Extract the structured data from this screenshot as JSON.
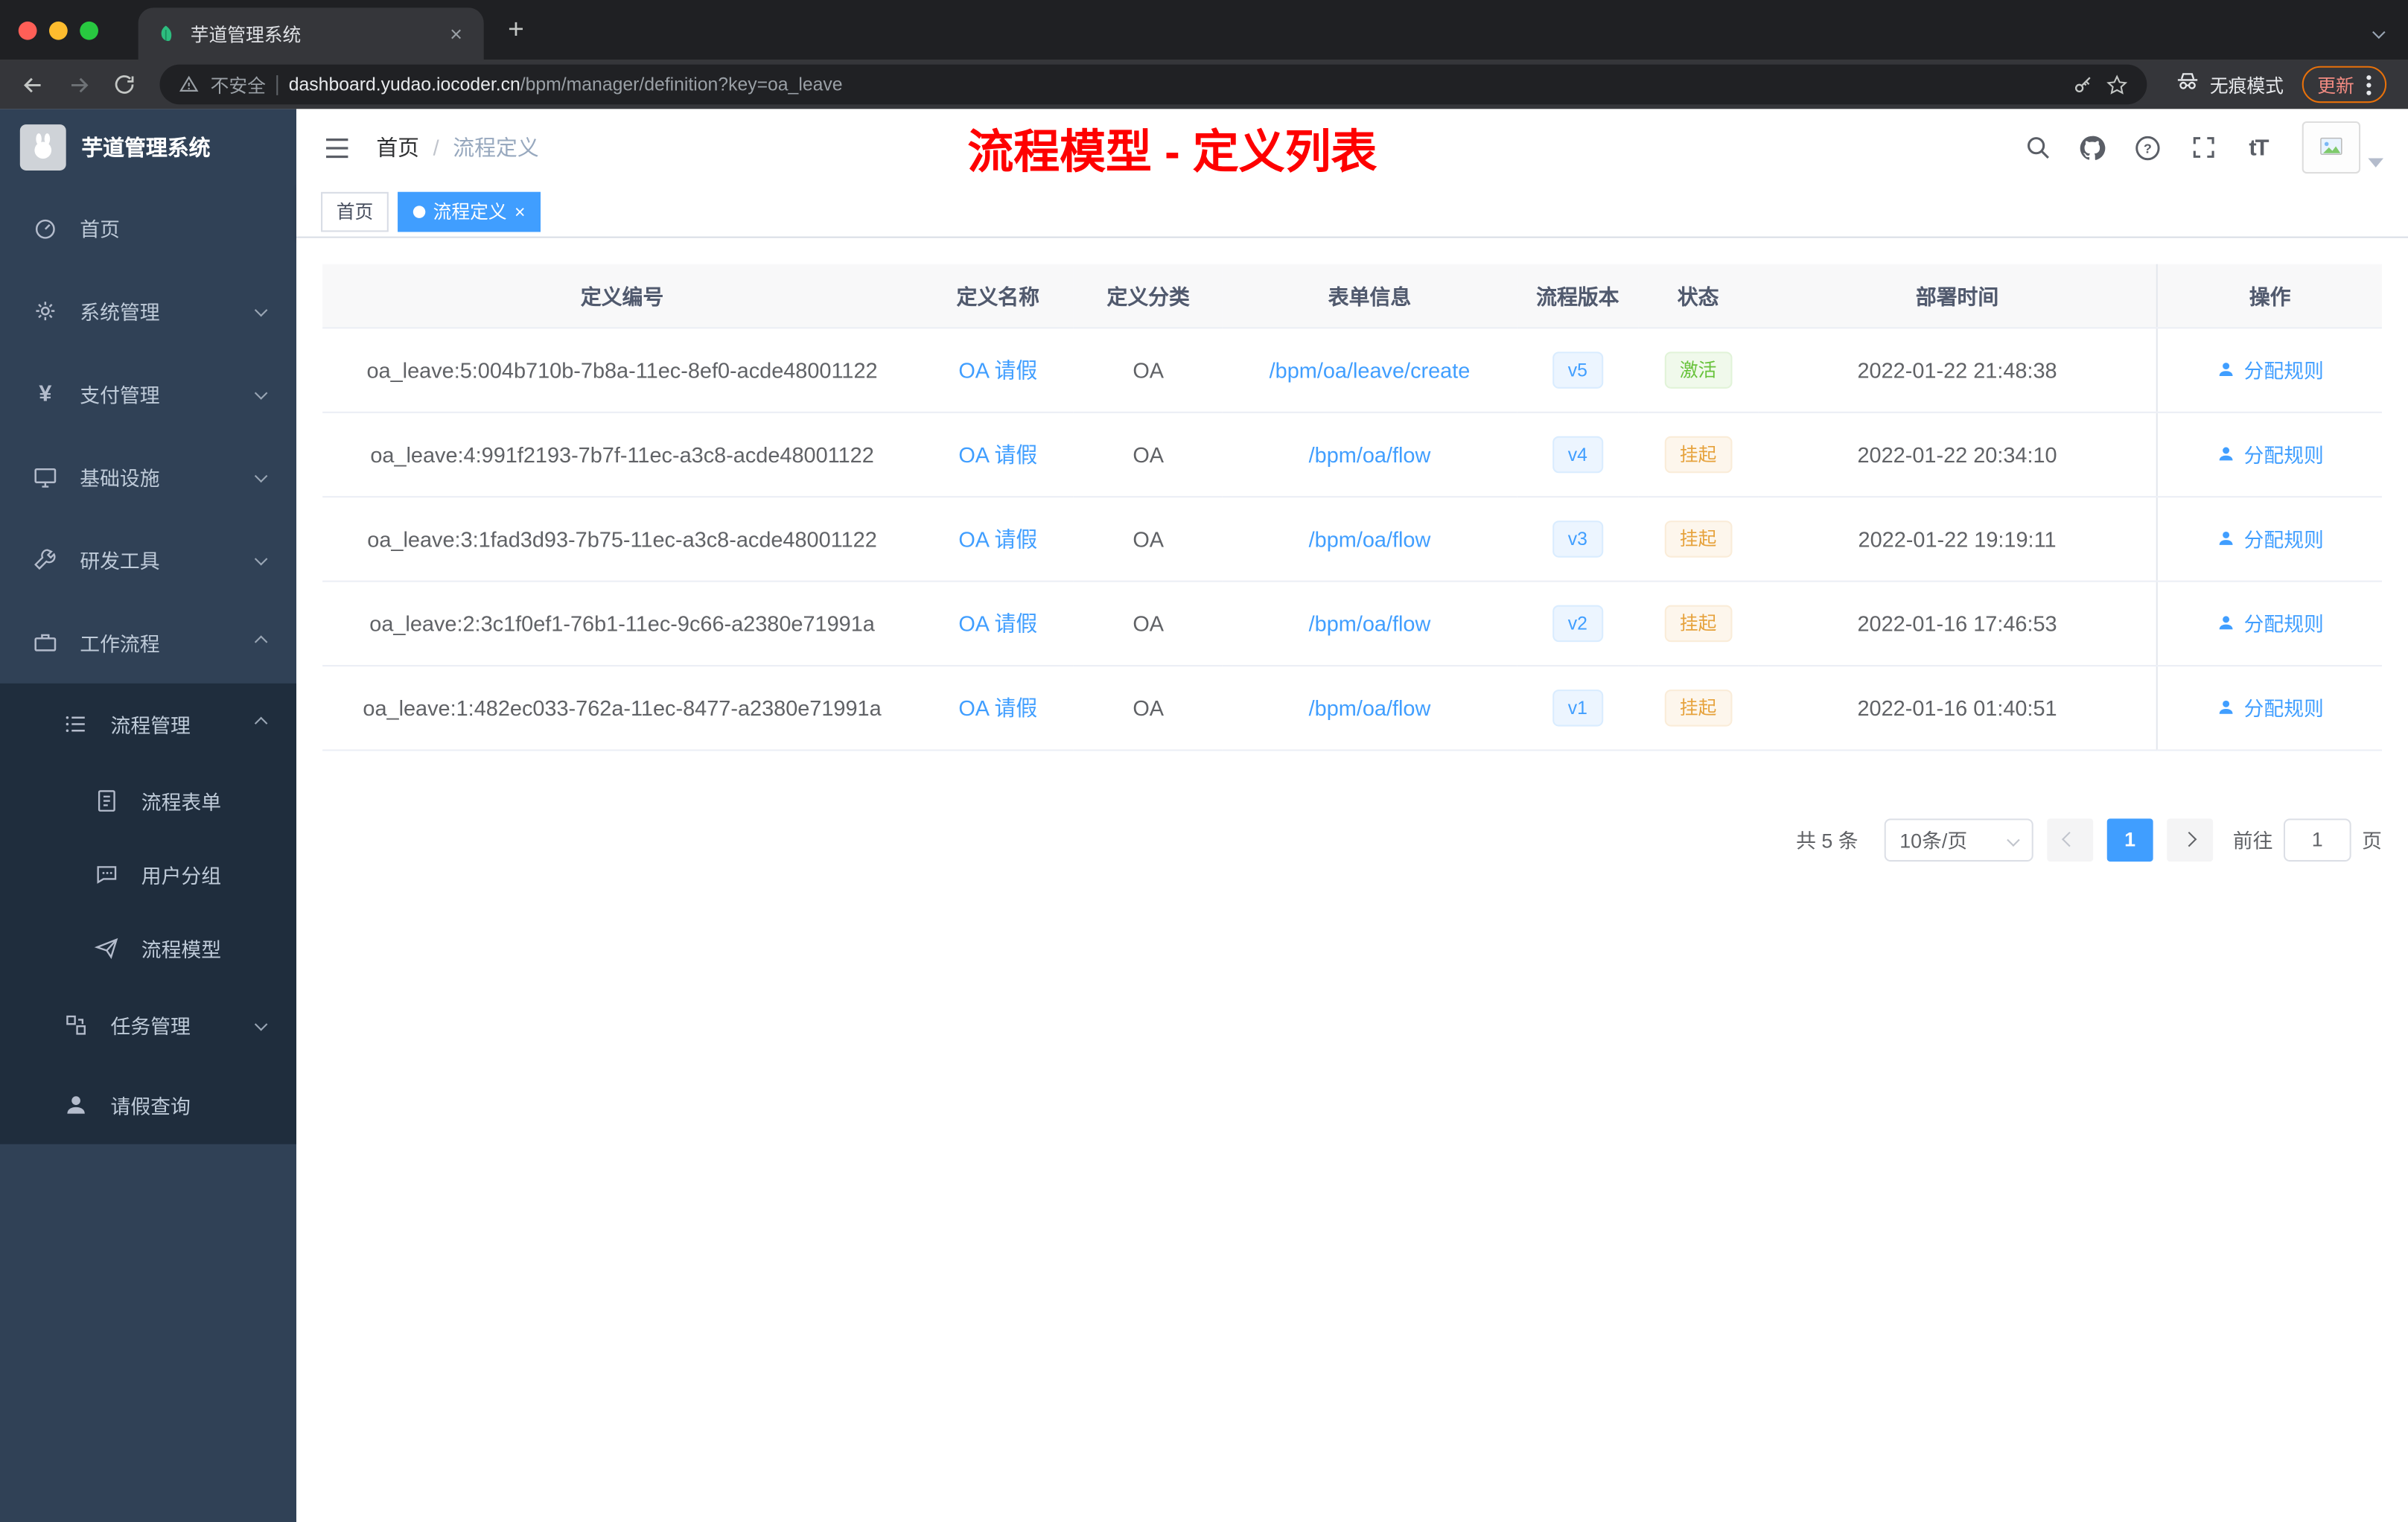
{
  "colors": {
    "accent": "#409eff",
    "sidebar_bg": "#304156",
    "submenu_bg": "#1f2d3d",
    "success": "#67c23a",
    "warning": "#e6a23c",
    "annotation_red": "#fe0000"
  },
  "browser": {
    "tab_title": "芋道管理系统",
    "security_label": "不安全",
    "url_domain": "dashboard.yudao.iocoder.cn",
    "url_path": "/bpm/manager/definition?key=oa_leave",
    "incognito_label": "无痕模式",
    "update_label": "更新"
  },
  "glyphs": {
    "close": "×",
    "plus": "+"
  },
  "sidebar": {
    "logo_title": "芋道管理系统",
    "items": [
      {
        "label": "首页"
      },
      {
        "label": "系统管理"
      },
      {
        "label": "支付管理"
      },
      {
        "label": "基础设施"
      },
      {
        "label": "研发工具"
      },
      {
        "label": "工作流程"
      },
      {
        "label": "流程管理"
      },
      {
        "label": "流程表单"
      },
      {
        "label": "用户分组"
      },
      {
        "label": "流程模型"
      },
      {
        "label": "任务管理"
      },
      {
        "label": "请假查询"
      }
    ]
  },
  "header": {
    "breadcrumb_home": "首页",
    "breadcrumb_sep": "/",
    "breadcrumb_current": "流程定义",
    "annotation": "流程模型 - 定义列表",
    "font_size_icon_label": "tT"
  },
  "tags": {
    "home": "首页",
    "active": "流程定义"
  },
  "table": {
    "columns": [
      "定义编号",
      "定义名称",
      "定义分类",
      "表单信息",
      "流程版本",
      "状态",
      "部署时间",
      "操作"
    ],
    "rows": [
      {
        "id": "oa_leave:5:004b710b-7b8a-11ec-8ef0-acde48001122",
        "name": "OA 请假",
        "category": "OA",
        "form": "/bpm/oa/leave/create",
        "version": "v5",
        "status": "激活",
        "time": "2022-01-22 21:48:38",
        "action": "分配规则"
      },
      {
        "id": "oa_leave:4:991f2193-7b7f-11ec-a3c8-acde48001122",
        "name": "OA 请假",
        "category": "OA",
        "form": "/bpm/oa/flow",
        "version": "v4",
        "status": "挂起",
        "time": "2022-01-22 20:34:10",
        "action": "分配规则"
      },
      {
        "id": "oa_leave:3:1fad3d93-7b75-11ec-a3c8-acde48001122",
        "name": "OA 请假",
        "category": "OA",
        "form": "/bpm/oa/flow",
        "version": "v3",
        "status": "挂起",
        "time": "2022-01-22 19:19:11",
        "action": "分配规则"
      },
      {
        "id": "oa_leave:2:3c1f0ef1-76b1-11ec-9c66-a2380e71991a",
        "name": "OA 请假",
        "category": "OA",
        "form": "/bpm/oa/flow",
        "version": "v2",
        "status": "挂起",
        "time": "2022-01-16 17:46:53",
        "action": "分配规则"
      },
      {
        "id": "oa_leave:1:482ec033-762a-11ec-8477-a2380e71991a",
        "name": "OA 请假",
        "category": "OA",
        "form": "/bpm/oa/flow",
        "version": "v1",
        "status": "挂起",
        "time": "2022-01-16 01:40:51",
        "action": "分配规则"
      }
    ]
  },
  "pagination": {
    "total": "共 5 条",
    "page_size": "10条/页",
    "current": "1",
    "goto_label": "前往",
    "goto_value": "1",
    "page_label": "页"
  }
}
